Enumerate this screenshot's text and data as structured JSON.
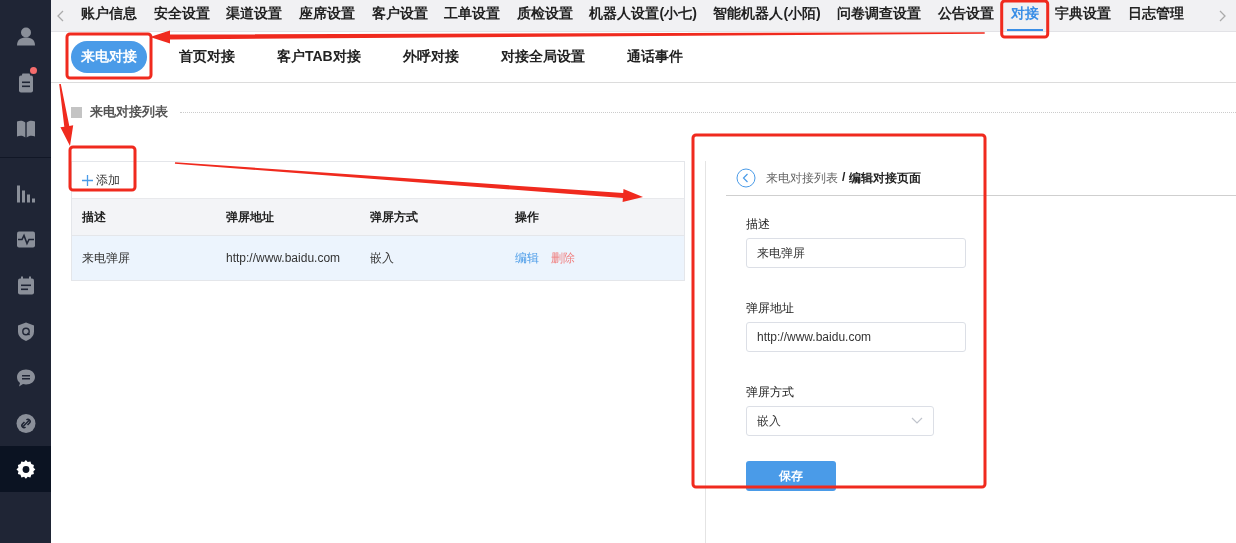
{
  "sidebar": {
    "items": [
      {
        "selected": false,
        "badge": false
      },
      {
        "selected": false,
        "badge": true
      },
      {
        "selected": false,
        "badge": false
      },
      {
        "selected": false,
        "badge": false
      },
      {
        "selected": false,
        "badge": false
      },
      {
        "selected": false,
        "badge": false
      },
      {
        "selected": false,
        "badge": false
      },
      {
        "selected": false,
        "badge": false
      },
      {
        "selected": false,
        "badge": false
      },
      {
        "selected": true,
        "badge": false
      }
    ]
  },
  "top_tabs": [
    {
      "label": "账户信息",
      "selected": false
    },
    {
      "label": "安全设置",
      "selected": false
    },
    {
      "label": "渠道设置",
      "selected": false
    },
    {
      "label": "座席设置",
      "selected": false
    },
    {
      "label": "客户设置",
      "selected": false
    },
    {
      "label": "工单设置",
      "selected": false
    },
    {
      "label": "质检设置",
      "selected": false
    },
    {
      "label": "机器人设置(小七)",
      "selected": false
    },
    {
      "label": "智能机器人(小陌)",
      "selected": false
    },
    {
      "label": "问卷调查设置",
      "selected": false
    },
    {
      "label": "公告设置",
      "selected": false
    },
    {
      "label": "对接",
      "selected": true
    },
    {
      "label": "宇典设置",
      "selected": false
    },
    {
      "label": "日志管理",
      "selected": false
    }
  ],
  "sub_tabs": [
    {
      "label": "来电对接",
      "selected": true
    },
    {
      "label": "首页对接",
      "selected": false
    },
    {
      "label": "客户TAB对接",
      "selected": false
    },
    {
      "label": "外呼对接",
      "selected": false
    },
    {
      "label": "对接全局设置",
      "selected": false
    },
    {
      "label": "通话事件",
      "selected": false
    }
  ],
  "section_title": "来电对接列表",
  "add_button": "添加",
  "table": {
    "columns": [
      "描述",
      "弹屏地址",
      "弹屏方式",
      "操作"
    ],
    "rows": [
      {
        "cells": [
          "来电弹屏",
          "http://www.baidu.com",
          "嵌入"
        ],
        "actions": [
          "编辑",
          "删除"
        ],
        "selected": true
      }
    ]
  },
  "edit_panel": {
    "breadcrumb": "来电对接列表",
    "separator": "/",
    "title": "编辑对接页面",
    "fields": [
      {
        "kind": "text",
        "label": "描述",
        "value": "来电弹屏"
      },
      {
        "kind": "text",
        "label": "弹屏地址",
        "value": "http://www.baidu.com"
      },
      {
        "kind": "select",
        "label": "弹屏方式",
        "value": "嵌入"
      }
    ],
    "save_button": "保存"
  },
  "annotations": [
    {
      "kind": "box"
    },
    {
      "kind": "box"
    },
    {
      "kind": "box"
    },
    {
      "kind": "box"
    },
    {
      "kind": "arrow"
    },
    {
      "kind": "arrow"
    },
    {
      "kind": "arrow"
    }
  ]
}
